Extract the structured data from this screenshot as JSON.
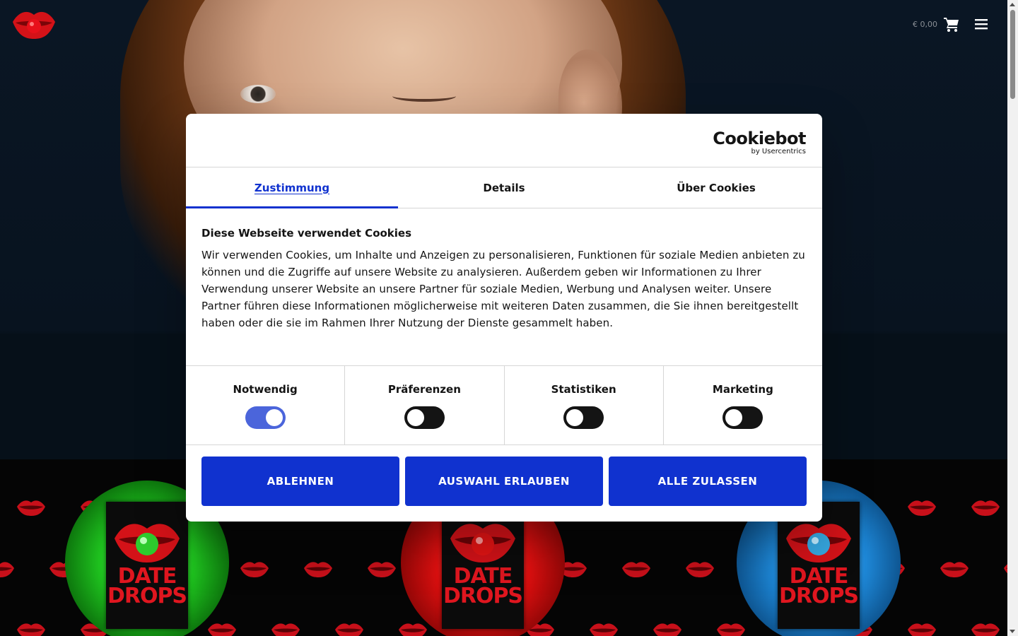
{
  "header": {
    "cart_price": "€ 0,00",
    "icons": {
      "logo": "lips-logo",
      "cart": "cart-icon",
      "menu": "hamburger-menu-icon"
    }
  },
  "cookie_dialog": {
    "brand": {
      "name": "Cookiebot",
      "by": "by Usercentrics"
    },
    "tabs": [
      {
        "label": "Zustimmung",
        "active": true
      },
      {
        "label": "Details",
        "active": false
      },
      {
        "label": "Über Cookies",
        "active": false
      }
    ],
    "title": "Diese Webseite verwendet Cookies",
    "text": "Wir verwenden Cookies, um Inhalte und Anzeigen zu personalisieren, Funktionen für soziale Medien anbieten zu können und die Zugriffe auf unsere Website zu analysieren. Außerdem geben wir Informationen zu Ihrer Verwendung unserer Website an unsere Partner für soziale Medien, Werbung und Analysen weiter. Unsere Partner führen diese Informationen möglicherweise mit weiteren Daten zusammen, die Sie ihnen bereitgestellt haben oder die sie im Rahmen Ihrer Nutzung der Dienste gesammelt haben.",
    "categories": [
      {
        "label": "Notwendig",
        "enabled": true
      },
      {
        "label": "Präferenzen",
        "enabled": false
      },
      {
        "label": "Statistiken",
        "enabled": false
      },
      {
        "label": "Marketing",
        "enabled": false
      }
    ],
    "buttons": {
      "decline": "ABLEHNEN",
      "allow_selection": "AUSWAHL ERLAUBEN",
      "allow_all": "ALLE ZULASSEN"
    }
  },
  "products": [
    {
      "brand": "DATE DROPS",
      "color": "#1fc41f",
      "drop_color": "#2ecc2e"
    },
    {
      "brand": "DATE DROPS",
      "color": "#e01010",
      "drop_color": "#e51414"
    },
    {
      "brand": "DATE DROPS",
      "color": "#1e88d8",
      "drop_color": "#36a7e0"
    }
  ],
  "colors": {
    "accent": "#1032cf",
    "brand_red": "#e0161f"
  }
}
